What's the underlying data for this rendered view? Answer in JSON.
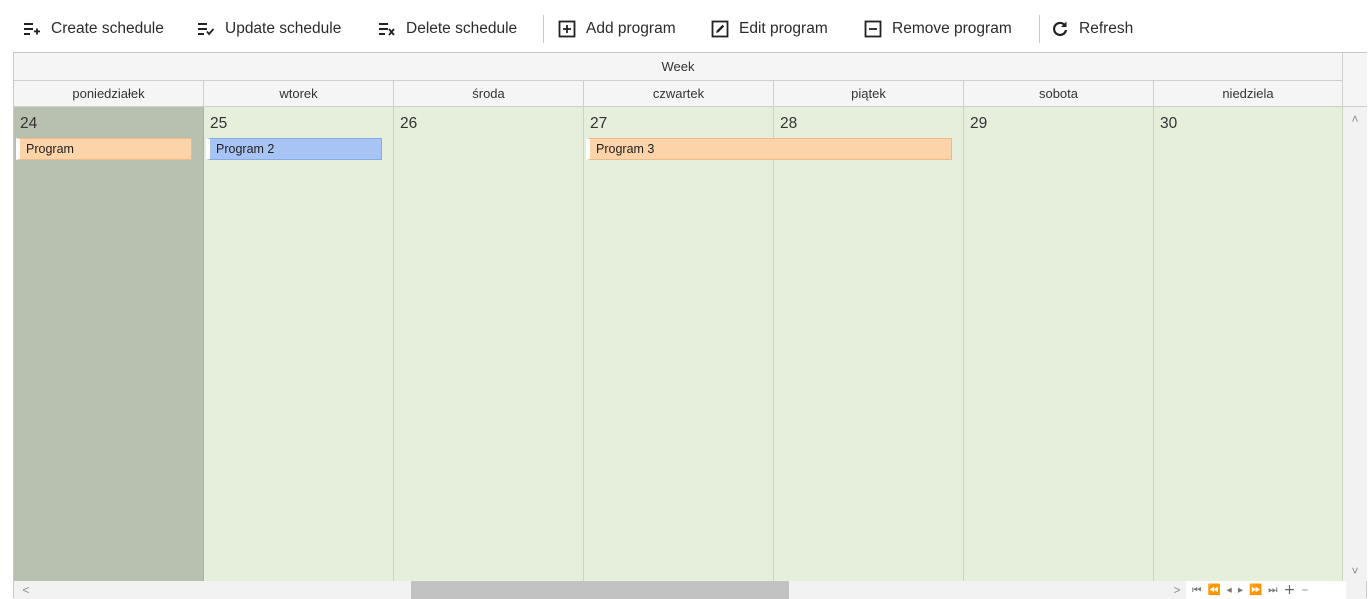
{
  "toolbar": {
    "create_schedule": "Create schedule",
    "update_schedule": "Update schedule",
    "delete_schedule": "Delete schedule",
    "add_program": "Add program",
    "edit_program": "Edit program",
    "remove_program": "Remove program",
    "refresh": "Refresh"
  },
  "scheduler": {
    "view_title": "Week",
    "days": [
      {
        "name": "poniedziałek",
        "date": "24"
      },
      {
        "name": "wtorek",
        "date": "25"
      },
      {
        "name": "środa",
        "date": "26"
      },
      {
        "name": "czwartek",
        "date": "27"
      },
      {
        "name": "piątek",
        "date": "28"
      },
      {
        "name": "sobota",
        "date": "29"
      },
      {
        "name": "niedziela",
        "date": "30"
      }
    ],
    "appointments": [
      {
        "label": "Program",
        "color": "#fdd3a9"
      },
      {
        "label": "Program 2",
        "color": "#a8c4f5"
      },
      {
        "label": "Program 3",
        "color": "#fdd3a9"
      }
    ]
  },
  "colors": {
    "day_background": "#e5efdc",
    "today_background": "#b8c0af"
  },
  "navigation": {
    "icons": [
      "scroll-right-icon",
      "first-page-icon",
      "fast-back-icon",
      "prev-icon",
      "next-icon",
      "fast-forward-icon",
      "last-page-icon",
      "zoom-in-icon",
      "zoom-out-icon"
    ]
  }
}
